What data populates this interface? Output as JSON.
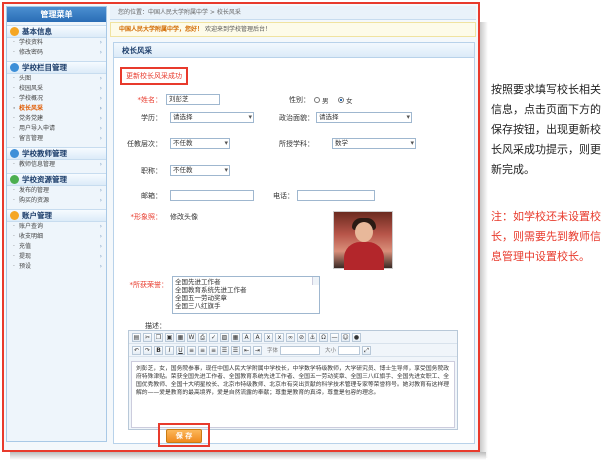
{
  "sidebar": {
    "title": "管理菜单",
    "groups": [
      {
        "title": "基本信息",
        "icon_color": "#f5a623",
        "items": [
          "学校资料",
          "修改密码"
        ]
      },
      {
        "title": "学校栏目管理",
        "icon_color": "#3d8fd8",
        "items": [
          "头图",
          "校园风采",
          "学校概况",
          "校长风采",
          "党务党建",
          "用户导入申请",
          "留言管理"
        ]
      },
      {
        "title": "学校教师管理",
        "icon_color": "#3d8fd8",
        "items": [
          "教师信息管理"
        ]
      },
      {
        "title": "学校资源管理",
        "icon_color": "#4caf50",
        "items": [
          "发布的管理",
          "购买的资源"
        ]
      },
      {
        "title": "账户管理",
        "icon_color": "#f5a623",
        "items": [
          "账户查询",
          "收支明细",
          "充值",
          "提现",
          "预设"
        ]
      }
    ],
    "active_item": "校长风采"
  },
  "topbar": {
    "breadcrumb": "您的位置：中国人民大学附属中学 > 校长风采"
  },
  "welcome": {
    "school": "中国人民大学附属中学，您好！",
    "text": "欢迎来到学校管理后台！"
  },
  "panel": {
    "title": "校长风采",
    "success_msg": "更新校长风采成功",
    "name_label": "*姓名：",
    "name_value": "刘彭芝",
    "gender_label": "性别：",
    "male": "男",
    "female": "女",
    "degree_label": "学历：",
    "degree_value": "请选择",
    "politics_label": "政治面貌：",
    "politics_value": "请选择",
    "level_label": "任教层次：",
    "level_value": "不任教",
    "subject_label": "所授学科：",
    "subject_value": "数学",
    "title_label": "职称：",
    "title_value": "不任教",
    "email_label": "邮箱：",
    "email_value": "",
    "phone_label": "电话：",
    "phone_value": "",
    "photo_label": "*形象照：",
    "photo_action": "修改头像",
    "honors_label": "*所获荣誉：",
    "honors": [
      "全国先进工作者",
      "全国教育系统先进工作者",
      "全国五一劳动奖章",
      "全国三八红旗手"
    ],
    "desc_label": "描述：",
    "editor_font_label": "字体",
    "editor_size_label": "大小",
    "editor_text": "刘彭芝，女，国务院参事，现任中国人民大学附属中学校长，中学数学特级教师，大学研究员、博士生导师，享受国务院政府特殊津贴。荣获全国先进工作者、全国教育系统先进工作者、全国五一劳动奖章、全国三八红旗手、全国先进女职工、全国优秀教师、全国十大明星校长、北京市特级教师、北京市有突出贡献的科学技术管理专家等荣誉称号。她对教育有这样理解的——爱是教育的最高境界，爱是自然流露的奉献；尊重是教育的真谛，尊重是包容的理念。",
    "save_label": "保 存"
  },
  "annotation": {
    "main": "按照要求填写校长相关信息，点击页面下方的保存按钮，出现更新校长风采成功提示，则更新完成。",
    "note": "注：如学校还未设置校长，则需要先到教师信息管理中设置校长。"
  }
}
